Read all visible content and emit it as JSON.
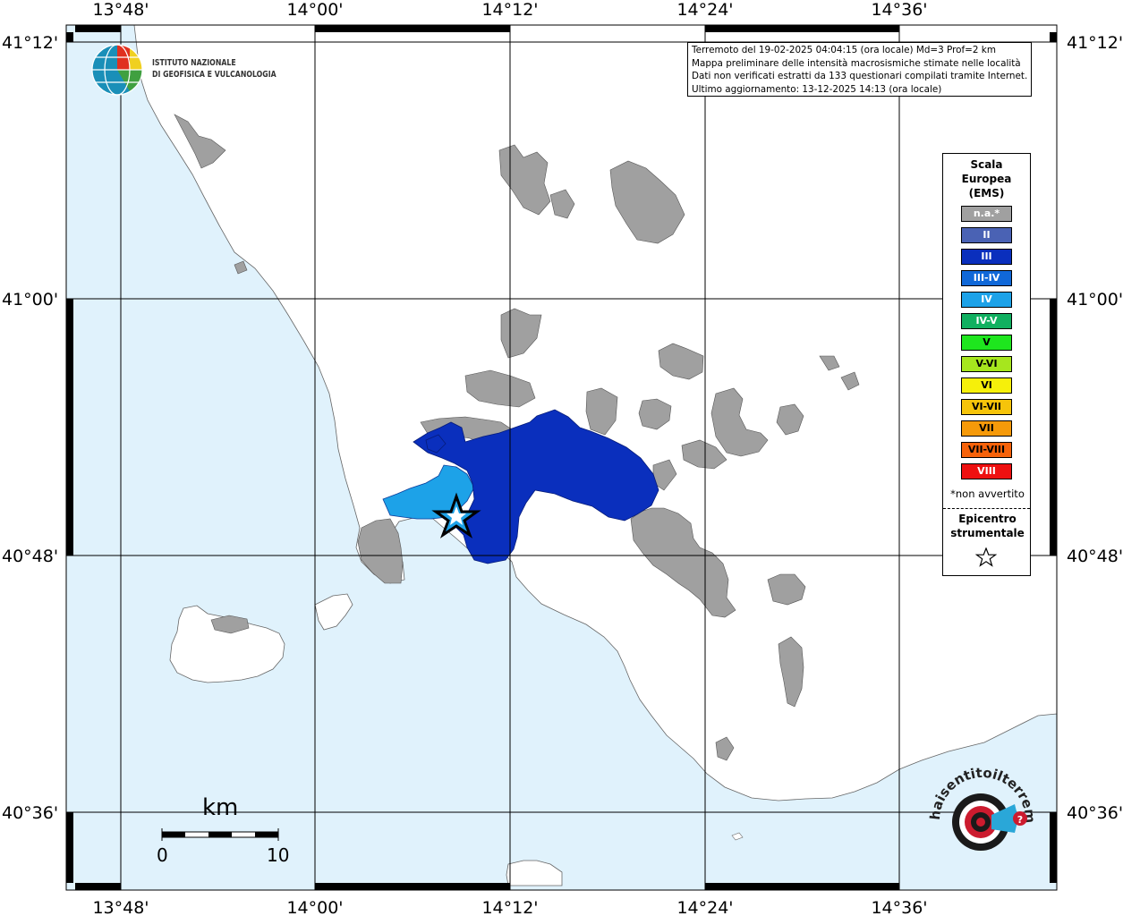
{
  "map": {
    "lon_labels": [
      "13°48'",
      "14°00'",
      "14°12'",
      "14°24'",
      "14°36'"
    ],
    "lat_labels": [
      "41°12'",
      "41°00'",
      "40°48'",
      "40°36'"
    ],
    "colors": {
      "sea": "#e0f2fc",
      "land": "#ffffff",
      "na_municipality": "#a0a0a0",
      "intensity_III": "#0a2fbd",
      "intensity_IV": "#1da2e8"
    }
  },
  "institute": {
    "line1": "ISTITUTO NAZIONALE",
    "line2": "DI GEOFISICA E VULCANOLOGIA",
    "logo_icon": "ingv-globe-icon"
  },
  "info": {
    "line1": "Terremoto del 19-02-2025 04:04:15 (ora locale) Md=3 Prof=2 km",
    "line2": "Mappa preliminare delle intensità macrosismiche stimate nelle località",
    "line3": "Dati non verificati estratti da 133 questionari compilati tramite Internet.",
    "line4": "Ultimo aggiornamento: 13-12-2025 14:13 (ora locale)"
  },
  "legend": {
    "title_line1": "Scala",
    "title_line2": "Europea",
    "title_line3": "(EMS)",
    "items": [
      {
        "label": "n.a.*",
        "color": "#a0a0a0"
      },
      {
        "label": "II",
        "color": "#4a62b4"
      },
      {
        "label": "III",
        "color": "#0a2fbd"
      },
      {
        "label": "III-IV",
        "color": "#1068d8"
      },
      {
        "label": "IV",
        "color": "#1da2e8"
      },
      {
        "label": "IV-V",
        "color": "#10b060"
      },
      {
        "label": "V",
        "color": "#1ee61e"
      },
      {
        "label": "V-VI",
        "color": "#a6e61e"
      },
      {
        "label": "VI",
        "color": "#f6f00a"
      },
      {
        "label": "VI-VII",
        "color": "#f6c40a"
      },
      {
        "label": "VII",
        "color": "#f69a0a"
      },
      {
        "label": "VII-VIII",
        "color": "#f6620a"
      },
      {
        "label": "VIII",
        "color": "#ee1010"
      }
    ],
    "note": "*non avvertito",
    "epicenter_line1": "Epicentro",
    "epicenter_line2": "strumentale",
    "epicenter_icon": "star-outline-icon"
  },
  "scale_bar": {
    "unit": "km",
    "min": "0",
    "max": "10"
  },
  "brand": {
    "text": "haisentitoilterremoto.it",
    "icon": "hai-sentito-logo-icon"
  }
}
